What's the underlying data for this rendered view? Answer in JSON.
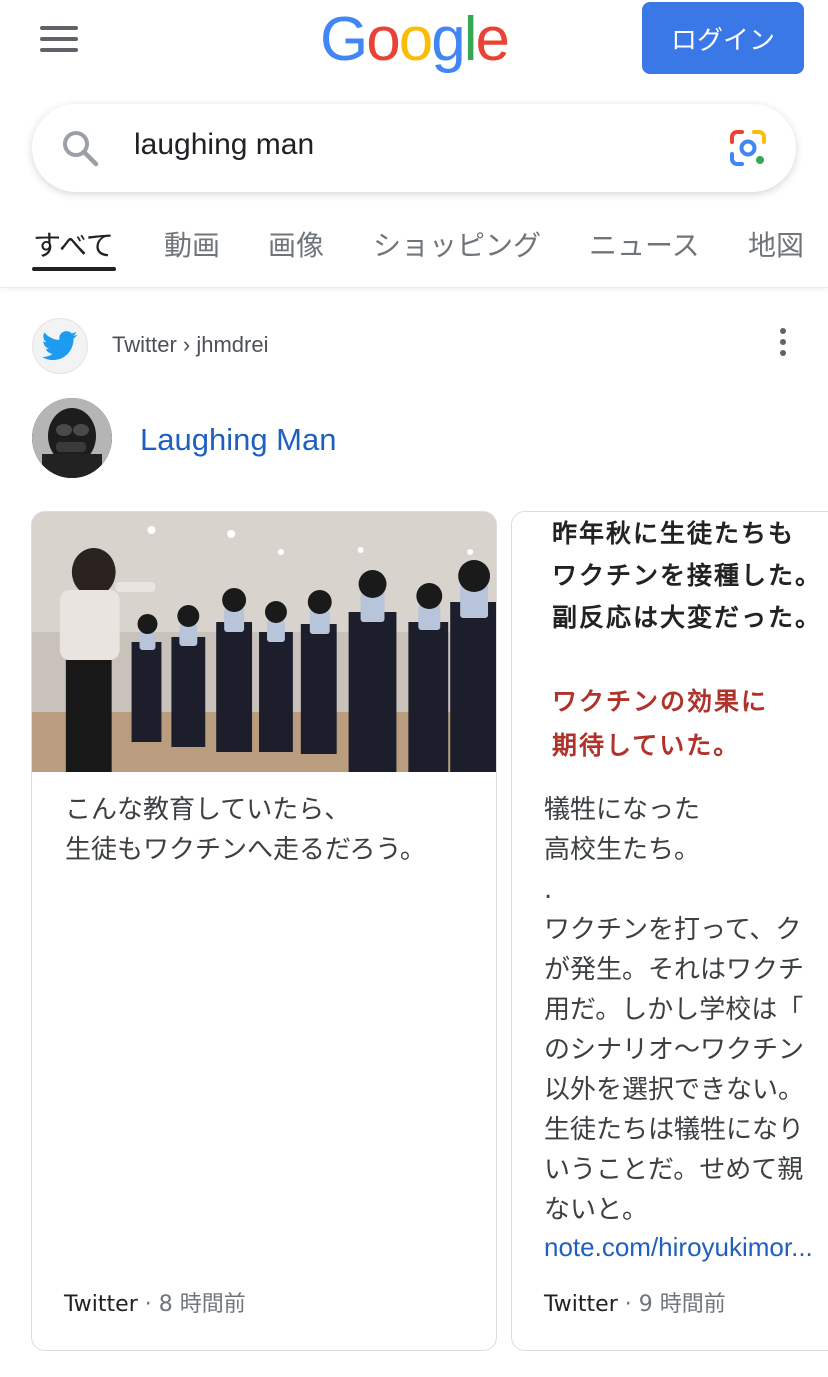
{
  "header": {
    "logo_letters": [
      "G",
      "o",
      "o",
      "g",
      "l",
      "e"
    ],
    "login_label": "ログイン"
  },
  "search": {
    "query": "laughing man"
  },
  "tabs": [
    {
      "label": "すべて",
      "active": true
    },
    {
      "label": "動画",
      "active": false
    },
    {
      "label": "画像",
      "active": false
    },
    {
      "label": "ショッピング",
      "active": false
    },
    {
      "label": "ニュース",
      "active": false
    },
    {
      "label": "地図",
      "active": false
    }
  ],
  "result": {
    "source": "Twitter › jhmdrei",
    "profile_name": "Laughing Man"
  },
  "cards": [
    {
      "text": "こんな教育していたら、\n生徒もワクチンへ走るだろう。",
      "source": "Twitter",
      "time": " · 8 時間前"
    },
    {
      "image_lines": [
        {
          "text": "昨年秋に生徒たちも",
          "color": "#222222"
        },
        {
          "text": "ワクチンを接種した。",
          "color": "#222222"
        },
        {
          "text": "副反応は大変だった。",
          "color": "#222222"
        },
        {
          "text": "ワクチンの効果に",
          "color": "#b0332b"
        },
        {
          "text": "期待していた。",
          "color": "#b0332b"
        }
      ],
      "text": "犠牲になった\n高校生たち。\n.\nワクチンを打って、ク\nが発生。それはワクチ\n用だ。しかし学校は「\nのシナリオ〜ワクチン\n以外を選択できない。\n生徒たちは犠牲になり\nいうことだ。せめて親\nないと。",
      "link": "note.com/hiroyukimor...",
      "source": "Twitter",
      "time": " · 9 時間前"
    }
  ],
  "colors": {
    "accent_blue": "#3b78e7",
    "link_blue": "#1f5fbf",
    "twitter_blue": "#1d9bf0"
  }
}
